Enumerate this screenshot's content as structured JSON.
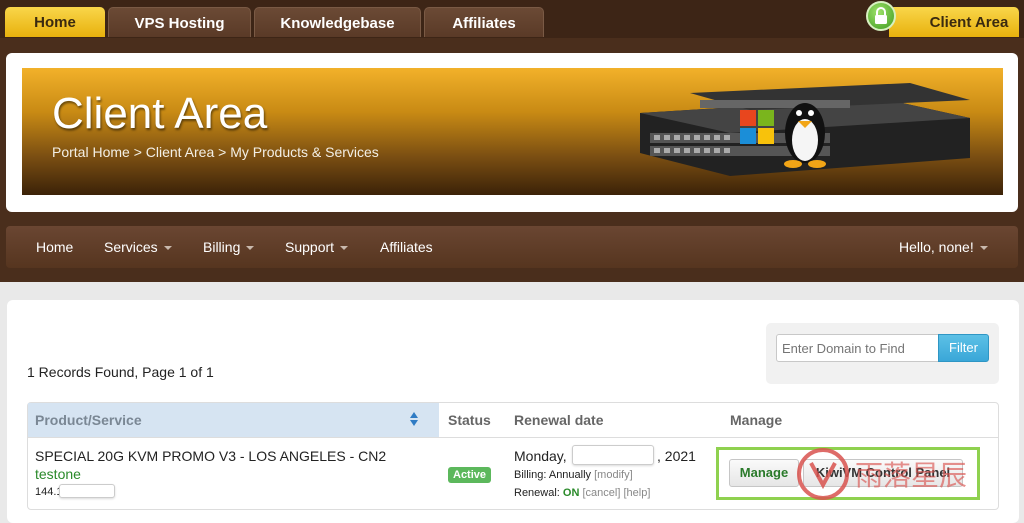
{
  "topnav": {
    "tabs": [
      {
        "label": "Home"
      },
      {
        "label": "VPS Hosting"
      },
      {
        "label": "Knowledgebase"
      },
      {
        "label": "Affiliates"
      }
    ],
    "client_area": "Client Area"
  },
  "banner": {
    "title": "Client Area",
    "breadcrumb": "Portal Home > Client Area > My Products & Services"
  },
  "mainnav": {
    "items": [
      {
        "label": "Home"
      },
      {
        "label": "Services"
      },
      {
        "label": "Billing"
      },
      {
        "label": "Support"
      },
      {
        "label": "Affiliates"
      }
    ],
    "greeting": "Hello, none!"
  },
  "records": "1 Records Found, Page 1 of 1",
  "search": {
    "placeholder": "Enter Domain to Find",
    "filter_label": "Filter"
  },
  "table": {
    "headers": {
      "product": "Product/Service",
      "status": "Status",
      "renewal": "Renewal date",
      "manage": "Manage"
    },
    "row": {
      "product": "SPECIAL 20G KVM PROMO V3 - LOS ANGELES - CN2",
      "username": "testone",
      "ip_prefix": "144.1",
      "status": "Active",
      "renew_day": "Monday, ",
      "renew_year": ", 2021",
      "billing_label": "Billing: Annually ",
      "modify": "[modify]",
      "renewal_label": "Renewal: ",
      "renewal_state": "ON",
      "cancel": "[cancel]",
      "help": "[help]",
      "manage_btn": "Manage",
      "panel_btn": "KiwiVM Control Panel"
    }
  },
  "watermark": "雨落星辰",
  "colors": {
    "accent_blue": "#3aa7d8",
    "active_green": "#5cb85c",
    "tab_yellow": "#e8b10d"
  }
}
